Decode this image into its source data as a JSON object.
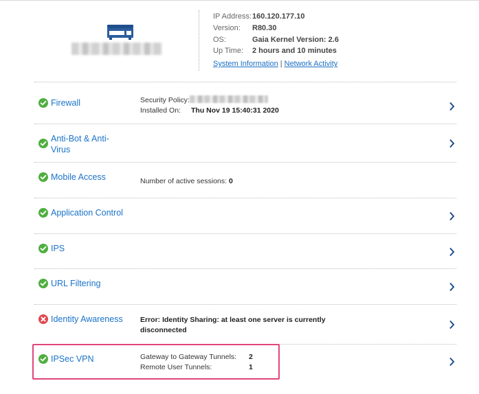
{
  "device": {
    "icon": "appliance-icon"
  },
  "info": {
    "ip_label": "IP Address:",
    "ip_value": "160.120.177.10",
    "version_label": "Version:",
    "version_value": "R80.30",
    "os_label": "OS:",
    "os_value": "Gaia Kernel Version: 2.6",
    "uptime_label": "Up Time:",
    "uptime_value": "2 hours and 10 minutes",
    "link_system": "System Information",
    "link_separator": "|",
    "link_network": "Network Activity"
  },
  "colors": {
    "ok": "#4fae3f",
    "error": "#e0484f",
    "link": "#1a73c8",
    "highlight": "#e0457a"
  },
  "blades": {
    "firewall": {
      "name": "Firewall",
      "status": "ok",
      "policy_label": "Security Policy:",
      "installed_label": "Installed On:",
      "installed_value": "Thu Nov 19 15:40:31 2020"
    },
    "antibot": {
      "name_line1": "Anti-Bot & Anti-",
      "name_line2": "Virus",
      "status": "ok"
    },
    "mobile": {
      "name": "Mobile Access",
      "status": "ok",
      "sessions_label": "Number of active sessions:",
      "sessions_value": "0"
    },
    "appcontrol": {
      "name": "Application Control",
      "status": "ok"
    },
    "ips": {
      "name": "IPS",
      "status": "ok"
    },
    "urlfiltering": {
      "name": "URL Filtering",
      "status": "ok"
    },
    "identity": {
      "name": "Identity Awareness",
      "status": "error",
      "error_line1": "Error: Identity Sharing: at least one server is currently",
      "error_line2": "disconnected"
    },
    "ipsec": {
      "name": "IPSec VPN",
      "status": "ok",
      "gw_label": "Gateway to Gateway Tunnels:",
      "gw_value": "2",
      "remote_label": "Remote User Tunnels:",
      "remote_value": "1"
    }
  }
}
